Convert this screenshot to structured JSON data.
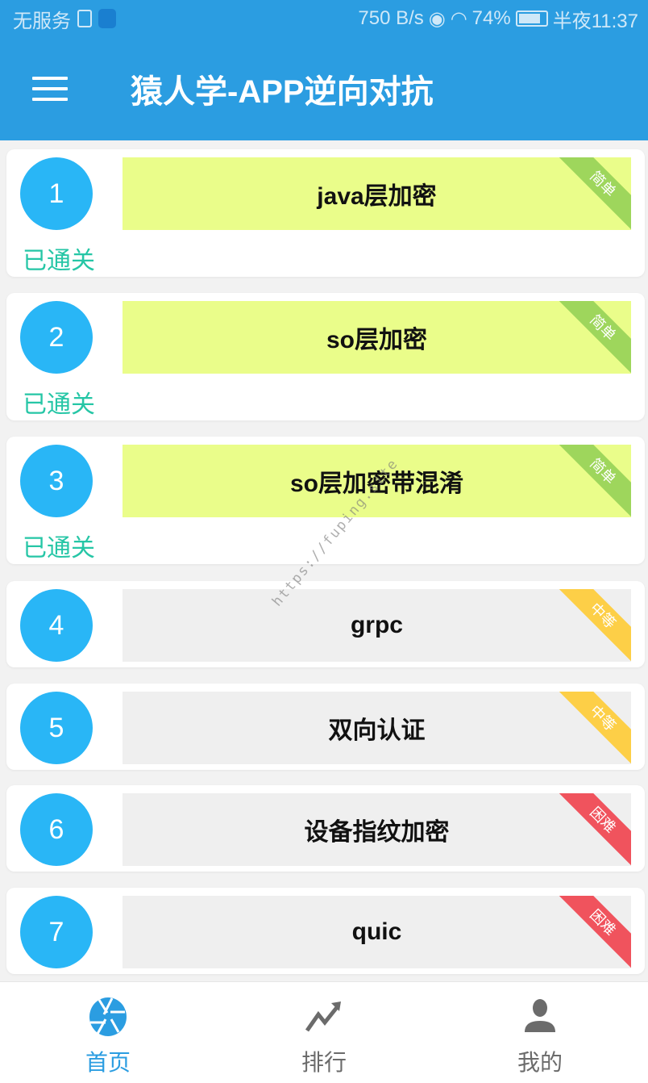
{
  "status_bar": {
    "carrier": "无服务",
    "speed": "750 B/s",
    "battery": "74%",
    "time": "半夜11:37"
  },
  "app_bar": {
    "title": "猿人学-APP逆向对抗"
  },
  "watermark": "https://fuping.site",
  "challenges": [
    {
      "number": "1",
      "title": "java层加密",
      "difficulty": "简单",
      "status": "已通关",
      "bg": "#eafd8a",
      "ribbon": "#9ed65c"
    },
    {
      "number": "2",
      "title": "so层加密",
      "difficulty": "简单",
      "status": "已通关",
      "bg": "#eafd8a",
      "ribbon": "#9ed65c"
    },
    {
      "number": "3",
      "title": "so层加密带混淆",
      "difficulty": "简单",
      "status": "已通关",
      "bg": "#eafd8a",
      "ribbon": "#9ed65c"
    },
    {
      "number": "4",
      "title": "grpc",
      "difficulty": "中等",
      "bg": "#efefef",
      "ribbon": "#fdcf47"
    },
    {
      "number": "5",
      "title": "双向认证",
      "difficulty": "中等",
      "bg": "#efefef",
      "ribbon": "#fdcf47"
    },
    {
      "number": "6",
      "title": "设备指纹加密",
      "difficulty": "困难",
      "bg": "#efefef",
      "ribbon": "#f0535d"
    },
    {
      "number": "7",
      "title": "quic",
      "difficulty": "困难",
      "bg": "#efefef",
      "ribbon": "#f0535d"
    }
  ],
  "bottom_nav": [
    {
      "label": "首页",
      "active": true
    },
    {
      "label": "排行"
    },
    {
      "label": "我的"
    }
  ]
}
